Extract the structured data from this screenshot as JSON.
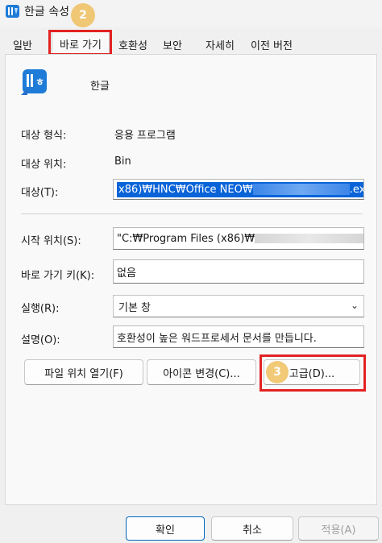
{
  "window": {
    "title": "한글 속성"
  },
  "steps": {
    "two": "2",
    "three": "3"
  },
  "tabs": [
    {
      "label": "일반"
    },
    {
      "label": "바로 가기"
    },
    {
      "label": "호환성"
    },
    {
      "label": "보안"
    },
    {
      "label": "자세히"
    },
    {
      "label": "이전 버전"
    }
  ],
  "app": {
    "name": "한글",
    "icon": "hwp-app-icon"
  },
  "fields": {
    "target_type_label": "대상 형식:",
    "target_type_value": "응용 프로그램",
    "target_location_label": "대상 위치:",
    "target_location_value": "Bin",
    "target_label": "대상(T):",
    "target_value_start": "x86)₩HNC₩Office NEO₩",
    "target_value_end": ".exe\"",
    "start_in_label": "시작 위치(S):",
    "start_in_value": "\"C:₩Program Files (x86)₩",
    "shortcut_key_label": "바로 가기 키(K):",
    "shortcut_key_value": "없음",
    "run_label": "실행(R):",
    "run_value": "기본 창",
    "comment_label": "설명(O):",
    "comment_value": "호환성이 높은 워드프로세서 문서를 만듭니다."
  },
  "buttons": {
    "open_location": "파일 위치 열기(F)",
    "change_icon": "아이콘 변경(C)...",
    "advanced": "고급(D)...",
    "ok": "확인",
    "cancel": "취소",
    "apply": "적용(A)"
  },
  "colors": {
    "highlight": "#e32222",
    "selection": "#0a64d8",
    "step_circle": "#f0c060"
  }
}
